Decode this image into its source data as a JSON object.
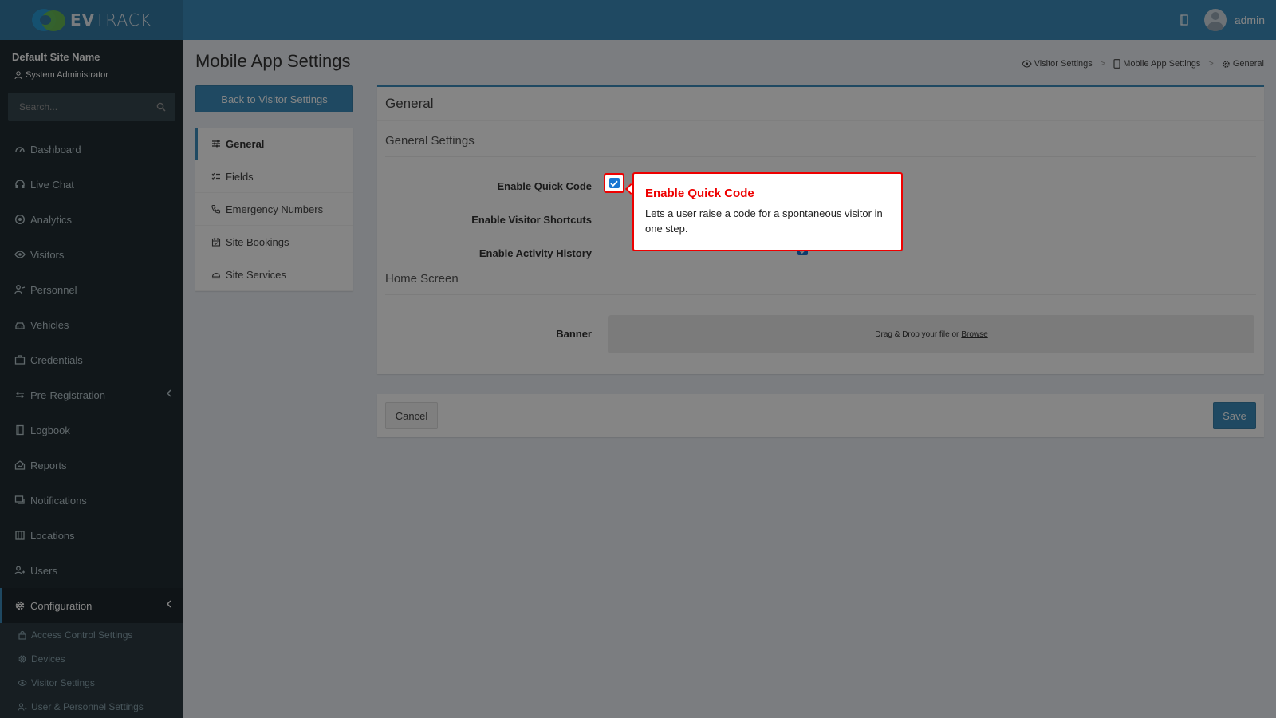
{
  "brand": {
    "logo_text_bold": "EV",
    "logo_text_light": "TRACK"
  },
  "topbar": {
    "username": "admin"
  },
  "sidebar": {
    "site_name": "Default Site Name",
    "role": "System Administrator",
    "search_placeholder": "Search...",
    "items": [
      {
        "label": "Dashboard",
        "icon": "dashboard-icon"
      },
      {
        "label": "Live Chat",
        "icon": "headset-icon"
      },
      {
        "label": "Analytics",
        "icon": "analytics-icon"
      },
      {
        "label": "Visitors",
        "icon": "eye-icon"
      },
      {
        "label": "Personnel",
        "icon": "personnel-icon"
      },
      {
        "label": "Vehicles",
        "icon": "car-icon"
      },
      {
        "label": "Credentials",
        "icon": "credentials-icon"
      },
      {
        "label": "Pre-Registration",
        "icon": "arrows-icon"
      },
      {
        "label": "Logbook",
        "icon": "book-icon"
      },
      {
        "label": "Reports",
        "icon": "reports-icon"
      },
      {
        "label": "Notifications",
        "icon": "chat-icon"
      },
      {
        "label": "Locations",
        "icon": "building-icon"
      },
      {
        "label": "Users",
        "icon": "users-icon"
      },
      {
        "label": "Configuration",
        "icon": "gear-icon"
      }
    ],
    "sub_items": [
      {
        "label": "Access Control Settings",
        "icon": "lock-icon"
      },
      {
        "label": "Devices",
        "icon": "gear-icon"
      },
      {
        "label": "Visitor Settings",
        "icon": "eye-icon"
      },
      {
        "label": "User & Personnel Settings",
        "icon": "users-icon"
      }
    ]
  },
  "page": {
    "title": "Mobile App Settings",
    "breadcrumb": [
      "Visitor Settings",
      "Mobile App Settings",
      "General"
    ],
    "breadcrumb_sep": ">",
    "back_button": "Back to Visitor Settings",
    "subnav": [
      "General",
      "Fields",
      "Emergency Numbers",
      "Site Bookings",
      "Site Services"
    ]
  },
  "form": {
    "box_title": "General",
    "section_general": "General Settings",
    "section_home": "Home Screen",
    "fields": [
      {
        "label": "Enable Quick Code",
        "checked": true
      },
      {
        "label": "Enable Visitor Shortcuts",
        "checked": true
      },
      {
        "label": "Enable Activity History",
        "checked": true
      }
    ],
    "banner_label": "Banner",
    "dropzone_text": "Drag & Drop your file or",
    "dropzone_link": "Browse"
  },
  "actions": {
    "cancel": "Cancel",
    "save": "Save"
  },
  "tooltip": {
    "title": "Enable Quick Code",
    "body": "Lets a user raise a code for a spontaneous visitor in one step."
  },
  "colors": {
    "accent": "#3c8dbc",
    "sidebar": "#222d32",
    "highlight": "#ee0000",
    "checkbox": "#1976d2"
  }
}
